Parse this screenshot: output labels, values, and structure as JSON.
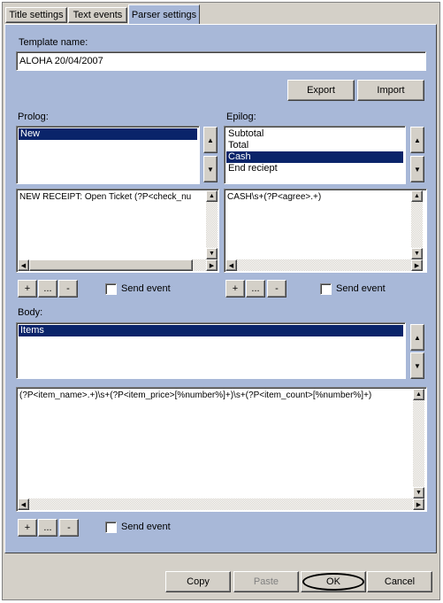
{
  "tabs": [
    {
      "label": "Title settings"
    },
    {
      "label": "Text events"
    },
    {
      "label": "Parser settings"
    }
  ],
  "template": {
    "label": "Template name:",
    "value": "ALOHA 20/04/2007"
  },
  "buttons": {
    "export": "Export",
    "import": "Import"
  },
  "prolog": {
    "label": "Prolog:",
    "items": [
      "New"
    ],
    "selected": 0,
    "text": "NEW RECEIPT: Open Ticket (?P<check_nu",
    "add": "+",
    "edit": "...",
    "remove": "-",
    "send_event": "Send event"
  },
  "epilog": {
    "label": "Epilog:",
    "items": [
      "Subtotal",
      "Total",
      "Cash",
      "End reciept"
    ],
    "selected": 2,
    "text": "CASH\\s+(?P<agree>.+)",
    "add": "+",
    "edit": "...",
    "remove": "-",
    "send_event": "Send event"
  },
  "body": {
    "label": "Body:",
    "items": [
      "Items"
    ],
    "selected": 0,
    "text": "(?P<item_name>.+)\\s+(?P<item_price>[%number%]+)\\s+(?P<item_count>[%number%]+)",
    "add": "+",
    "edit": "...",
    "remove": "-",
    "send_event": "Send event"
  },
  "footer": {
    "copy": "Copy",
    "paste": "Paste",
    "ok": "OK",
    "cancel": "Cancel"
  },
  "colors": {
    "panel": "#a8b8d8",
    "selection": "#0a246a",
    "face": "#d4d0c8"
  }
}
